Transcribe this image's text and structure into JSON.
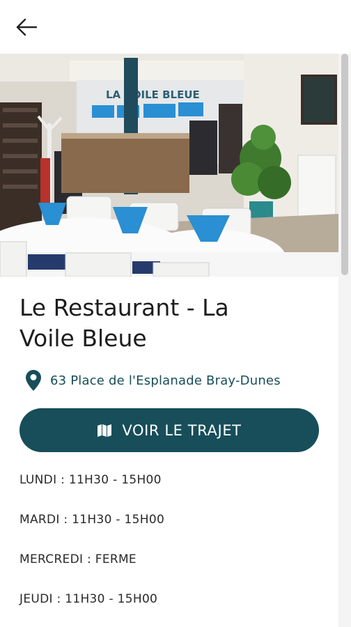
{
  "header": {
    "back_icon": "arrow-left-icon"
  },
  "hero": {
    "sign_text": "LA VOILE BLEUE",
    "accent_color": "#2a8fd3"
  },
  "restaurant": {
    "name_line1": "Le Restaurant - La",
    "name_line2": "Voile Bleue",
    "address_icon": "map-pin-icon",
    "address": "63 Place de l'Esplanade Bray-Dunes"
  },
  "route_button": {
    "icon": "map-icon",
    "label": "VOIR LE TRAJET"
  },
  "hours": [
    "LUNDI : 11H30 - 15H00",
    "MARDI : 11H30 - 15H00",
    "MERCREDI : FERME",
    "JEUDI : 11H30 - 15H00"
  ],
  "colors": {
    "primary": "#174e5a",
    "text": "#1d1d1d",
    "background": "#ffffff"
  }
}
